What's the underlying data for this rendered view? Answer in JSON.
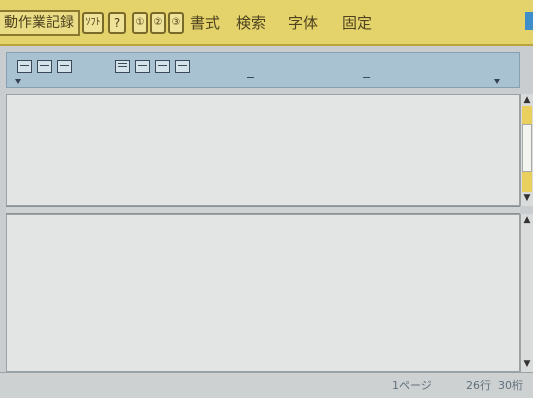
{
  "menubar": {
    "app_title": "動作業記録",
    "btn_mode": "ｿﾌﾄ",
    "btn_help": "?",
    "btn_icons": [
      "①",
      "②",
      "③"
    ],
    "menus": [
      "書式",
      "検索",
      "字体",
      "固定"
    ]
  },
  "status": {
    "page": "1ページ",
    "line": "26行",
    "col": "30桁"
  }
}
